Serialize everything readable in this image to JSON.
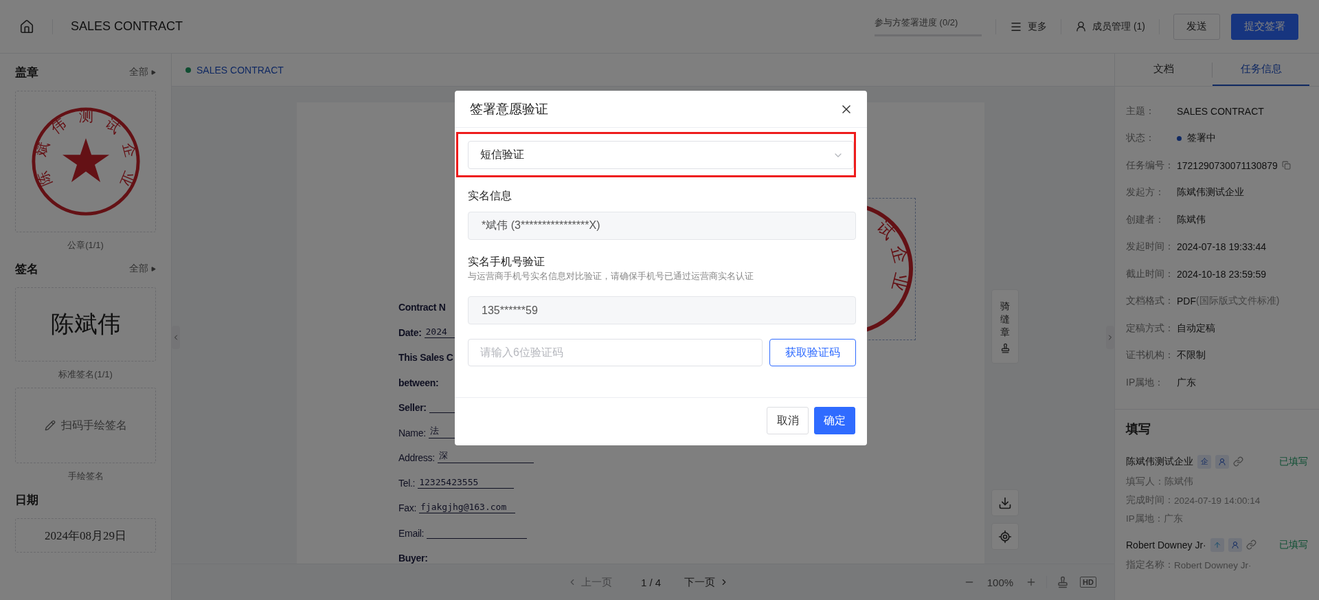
{
  "top_bar": {
    "title": "SALES CONTRACT",
    "progress": {
      "label": "参与方签署进度 (0/2)",
      "level": 0
    },
    "more": "更多",
    "members": "成员管理 (1)",
    "buttons": [
      {
        "label": "发送",
        "kind": "outline"
      },
      {
        "label": "提交签署",
        "kind": "primary"
      }
    ]
  },
  "left_sidebar": {
    "sections": [
      {
        "title": "盖章",
        "link": "全部",
        "cards": [
          {
            "kind": "seal",
            "text": "陈斌伟测试企业",
            "caption": "公章(1/1)"
          }
        ]
      },
      {
        "title": "签名",
        "link": "全部",
        "cards": [
          {
            "kind": "signature",
            "text": "陈斌伟",
            "caption": "标准签名(1/1)"
          },
          {
            "kind": "scan",
            "text": "扫码手绘签名",
            "caption": "手绘签名"
          }
        ]
      },
      {
        "title": "日期",
        "cards": [
          {
            "kind": "date",
            "text": "2024年08月29日"
          }
        ]
      }
    ]
  },
  "document": {
    "tab": "SALES CONTRACT",
    "lines": [
      {
        "kind": "heading",
        "text": "Contract N"
      },
      {
        "kind": "field",
        "bold": true,
        "label": "Date:",
        "value": "2024"
      },
      {
        "kind": "heading",
        "text": "This Sales C"
      },
      {
        "kind": "heading",
        "text": "between:"
      },
      {
        "kind": "field",
        "bold": true,
        "label": "Seller:"
      },
      {
        "kind": "field",
        "bold": false,
        "label": "Name:",
        "value": "法"
      },
      {
        "kind": "field",
        "bold": false,
        "label": "Address:",
        "value": "深"
      },
      {
        "kind": "field",
        "bold": false,
        "label": "Tel.:",
        "value": "12325423555"
      },
      {
        "kind": "field",
        "bold": false,
        "label": "Fax:",
        "value": "fjakgjhg@163.com"
      },
      {
        "kind": "field",
        "bold": false,
        "label": "Email:"
      },
      {
        "kind": "heading",
        "text": "Buyer:"
      }
    ],
    "stamp_text": "试企业",
    "seam_seal": "骑缝章",
    "pager": {
      "prev": {
        "label": "上一页",
        "disabled": true
      },
      "page": "1 / 4",
      "next": {
        "label": "下一页",
        "disabled": false
      },
      "zoom": "100%",
      "hd": "HD"
    }
  },
  "right_panel": {
    "tabs": [
      {
        "label": "文档",
        "selected": false
      },
      {
        "label": "任务信息",
        "selected": true
      }
    ],
    "info": [
      {
        "kind": "text",
        "label": "主题：",
        "value": "SALES CONTRACT"
      },
      {
        "kind": "status",
        "label": "状态：",
        "value": "签署中"
      },
      {
        "kind": "copy",
        "label": "任务编号：",
        "value": "1721290730071130879"
      },
      {
        "kind": "text",
        "label": "发起方：",
        "value": "陈斌伟测试企业"
      },
      {
        "kind": "text",
        "label": "创建者：",
        "value": "陈斌伟"
      },
      {
        "kind": "text",
        "label": "发起时间：",
        "value": "2024-07-18 19:33:44"
      },
      {
        "kind": "text",
        "label": "截止时间：",
        "value": "2024-10-18 23:59:59"
      },
      {
        "kind": "note",
        "label": "文档格式：",
        "value": "PDF",
        "note": "(国际版式文件标准)"
      },
      {
        "kind": "text",
        "label": "定稿方式：",
        "value": "自动定稿"
      },
      {
        "kind": "text",
        "label": "证书机构：",
        "value": "不限制"
      },
      {
        "kind": "text",
        "label": "IP属地：",
        "value": "广东"
      }
    ],
    "fill": {
      "title": "填写",
      "parties": [
        {
          "name": "陈斌伟测试企业",
          "badge": {
            "kind": "enterprise",
            "text": "企"
          },
          "status": "已填写",
          "details": [
            {
              "label": "填写人：",
              "value": "陈斌伟"
            },
            {
              "label": "完成时间：",
              "value": "2024-07-19 14:00:14"
            },
            {
              "label": "IP属地：",
              "value": "广东"
            }
          ]
        },
        {
          "name": "Robert Downey Jr·",
          "badge": {
            "kind": "external"
          },
          "status": "已填写",
          "details": [
            {
              "label": "指定名称：",
              "value": "Robert Downey Jr·"
            }
          ]
        }
      ]
    }
  },
  "dialog": {
    "title": "签署意愿验证",
    "method": {
      "value": "短信验证",
      "highlighted": true
    },
    "identity": {
      "label": "实名信息",
      "value": "*斌伟 (3****************X)"
    },
    "phone": {
      "label": "实名手机号验证",
      "hint": "与运营商手机号实名信息对比验证，请确保手机号已通过运营商实名认证",
      "value": "135******59"
    },
    "code": {
      "placeholder": "请输入6位验证码",
      "button": "获取验证码"
    },
    "buttons": [
      {
        "label": "取消",
        "kind": "default"
      },
      {
        "label": "确定",
        "kind": "primary"
      }
    ]
  }
}
